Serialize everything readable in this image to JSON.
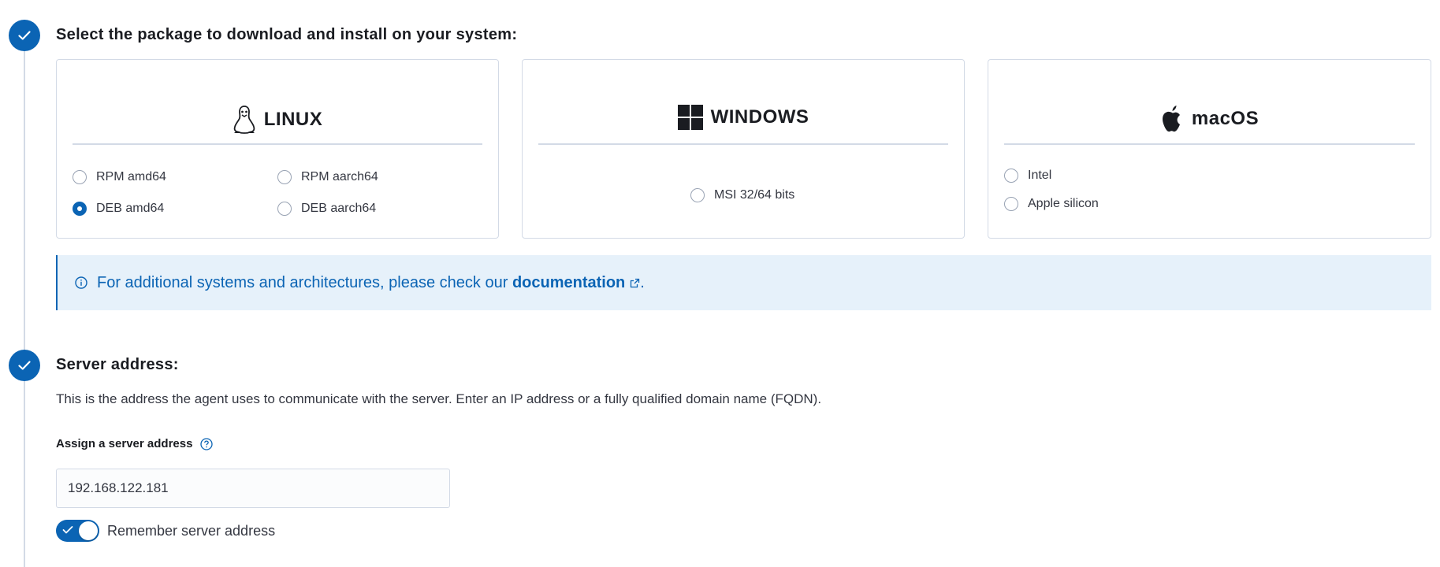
{
  "steps": {
    "package": {
      "title": "Select the package to download and install on your system:"
    },
    "server": {
      "title": "Server address:",
      "description": "This is the address the agent uses to communicate with the server. Enter an IP address or a fully qualified domain name (FQDN).",
      "field_label": "Assign a server address",
      "field_value": "192.168.122.181",
      "toggle_label": "Remember server address",
      "toggle_on": true
    }
  },
  "cards": {
    "linux": {
      "title": "LINUX",
      "options": [
        "RPM amd64",
        "RPM aarch64",
        "DEB amd64",
        "DEB aarch64"
      ],
      "selected": "DEB amd64"
    },
    "windows": {
      "title": "WINDOWS",
      "options": [
        "MSI 32/64 bits"
      ]
    },
    "macos": {
      "title": "macOS",
      "options": [
        "Intel",
        "Apple silicon"
      ]
    }
  },
  "callout": {
    "text": "For additional systems and architectures, please check our ",
    "link": "documentation",
    "suffix": "."
  },
  "colors": {
    "accent": "#0b64b4",
    "callout_bg": "#e6f1fa"
  },
  "icons": [
    "check-icon",
    "linux-penguin-icon",
    "windows-logo-icon",
    "apple-logo-icon",
    "info-icon",
    "external-link-icon",
    "question-circle-icon"
  ]
}
